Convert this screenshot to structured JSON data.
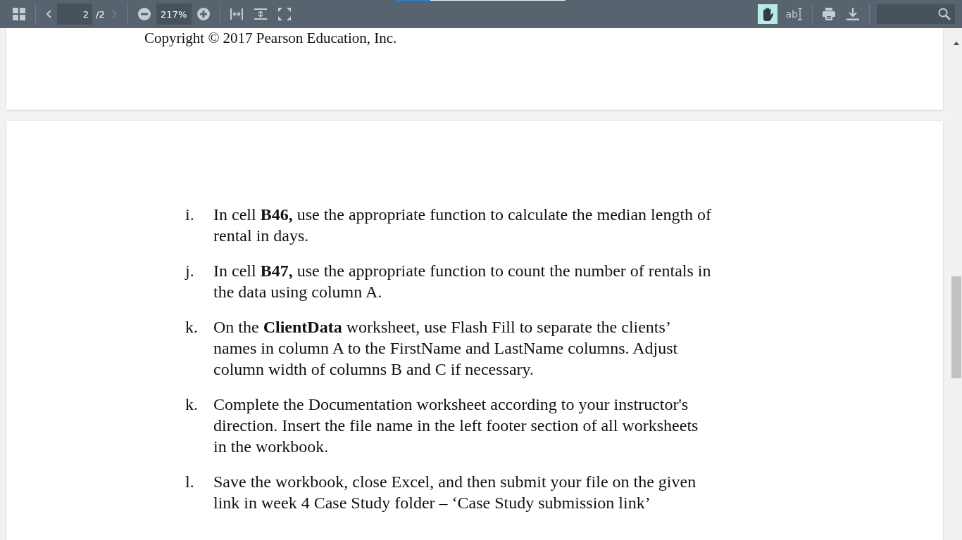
{
  "toolbar": {
    "previous_page": {
      "disabled": false
    },
    "page_number": "2",
    "page_count": "/2",
    "next_page": {
      "disabled": true
    },
    "zoom": "217%",
    "tools": [
      {
        "kind": "hand",
        "selected": true
      },
      {
        "kind": "text",
        "label": "ab",
        "selected": false
      }
    ]
  },
  "loading_bar": {
    "level": 0.2
  },
  "pages": [
    {
      "kind": "footer",
      "text": "Copyright © 2017 Pearson Education, Inc."
    },
    {
      "kind": "list",
      "items": [
        {
          "marker": "i.",
          "text": "In cell **B46,** use the appropriate function to calculate the median length of rental in days."
        },
        {
          "marker": "j.",
          "text": "In cell **B47,** use the appropriate function to count the number of rentals in the data using column A."
        },
        {
          "marker": "k.",
          "text": "On the **ClientData** worksheet, use Flash Fill to separate the clients’ names in column A to the FirstName and LastName columns. Adjust column width of columns B and C if necessary."
        },
        {
          "marker": "k.",
          "text": "Complete the Documentation worksheet according to your instructor's direction. Insert the file name in the left footer section of all worksheets in the workbook."
        },
        {
          "marker": "l.",
          "text": "Save the workbook, close Excel, and then submit your file on the given link in week 4 Case Study folder – ‘Case Study submission link’"
        }
      ]
    }
  ]
}
